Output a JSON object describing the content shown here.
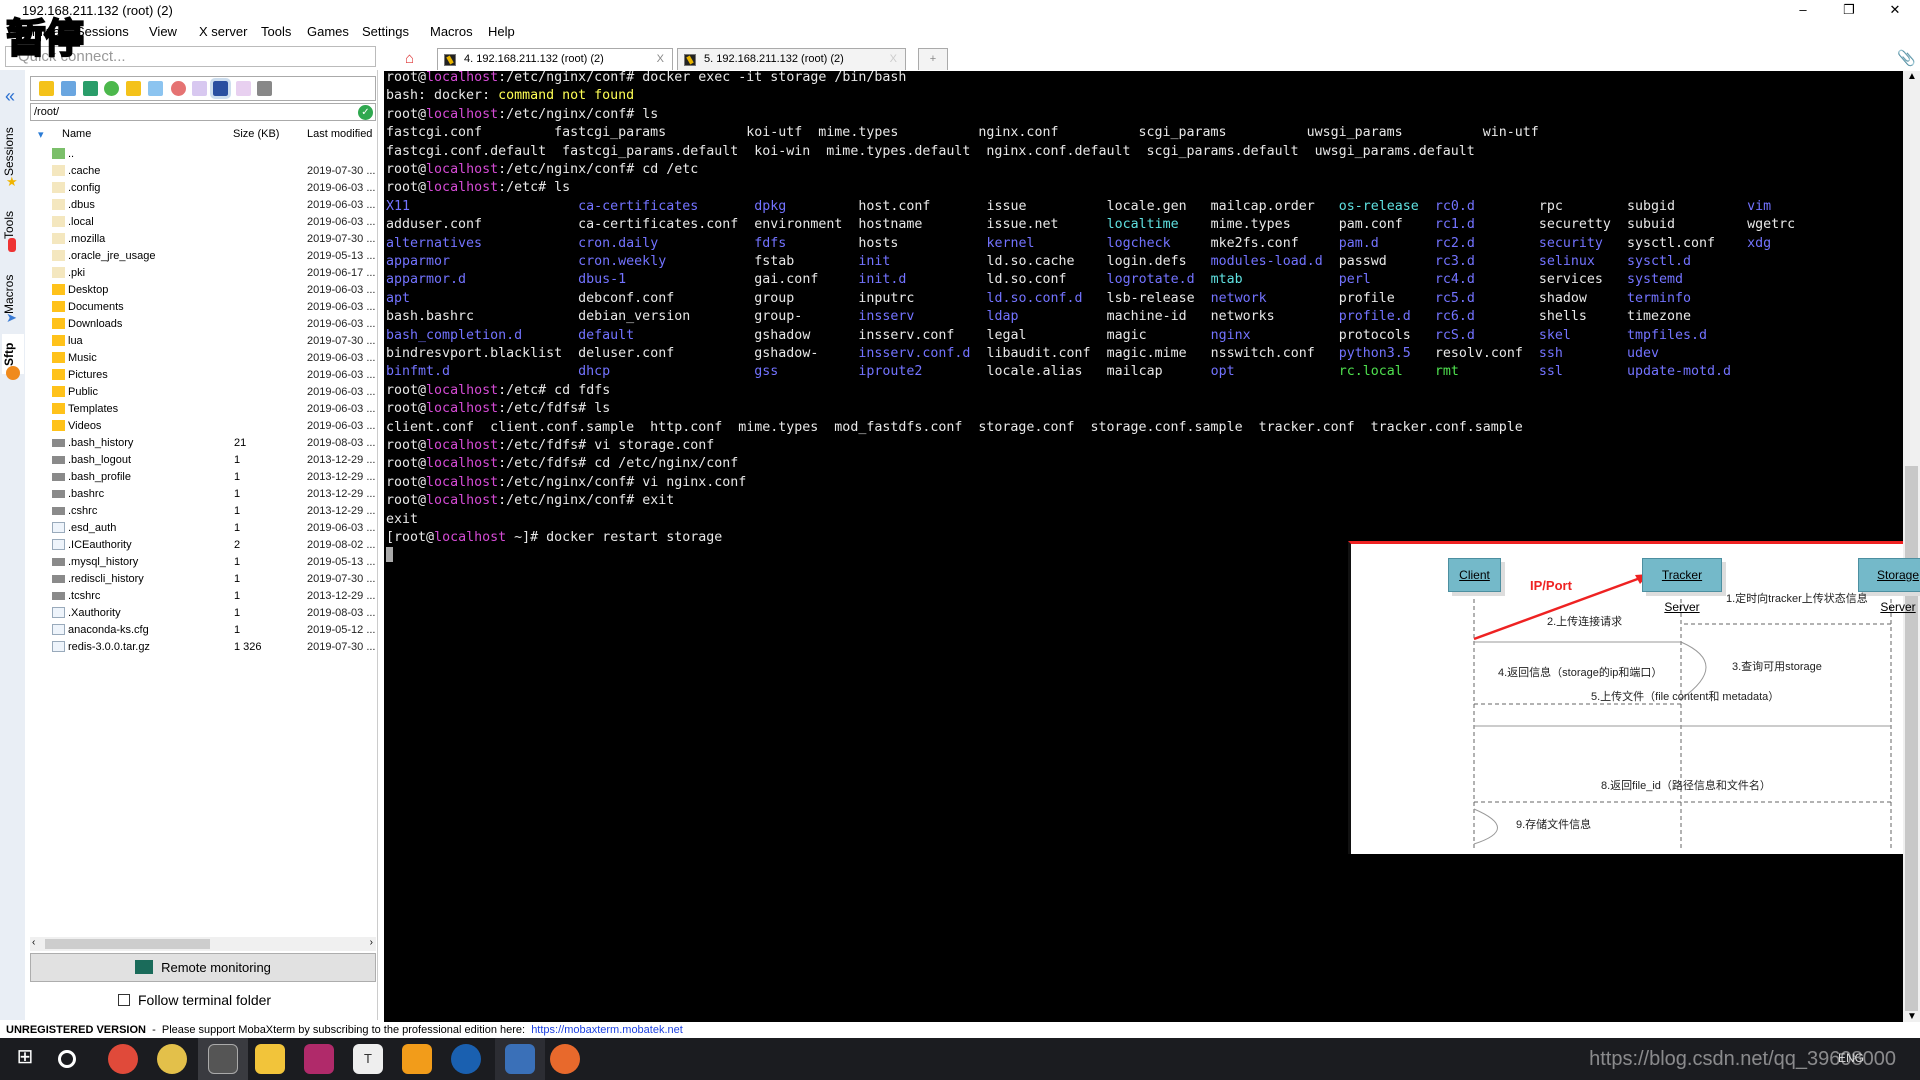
{
  "window": {
    "title": "192.168.211.132 (root) (2)",
    "minimize": "–",
    "maximize": "❐",
    "close": "✕"
  },
  "overlay_text": "暂停",
  "menu": [
    "Terminal",
    "Sessions",
    "View",
    "X server",
    "Tools",
    "Games",
    "Settings",
    "Macros",
    "Help"
  ],
  "quick_connect": {
    "placeholder": "Quick connect..."
  },
  "tabs": [
    {
      "label": "4. 192.168.211.132 (root) (2)",
      "close": "X",
      "active": true
    },
    {
      "label": "5. 192.168.211.132 (root) (2)",
      "close": "X",
      "active": false
    }
  ],
  "side_tabs": [
    "Sessions",
    "Tools",
    "Macros",
    "Sftp"
  ],
  "sftp": {
    "path": "/root/",
    "columns": {
      "name": "Name",
      "size": "Size (KB)",
      "modified": "Last modified"
    },
    "files": [
      {
        "name": "..",
        "size": "",
        "modified": "",
        "icon": "parent"
      },
      {
        "name": ".cache",
        "size": "",
        "modified": "2019-07-30 ...",
        "icon": "folder-dot"
      },
      {
        "name": ".config",
        "size": "",
        "modified": "2019-06-03 ...",
        "icon": "folder-dot"
      },
      {
        "name": ".dbus",
        "size": "",
        "modified": "2019-06-03 ...",
        "icon": "folder-dot"
      },
      {
        "name": ".local",
        "size": "",
        "modified": "2019-06-03 ...",
        "icon": "folder-dot"
      },
      {
        "name": ".mozilla",
        "size": "",
        "modified": "2019-07-30 ...",
        "icon": "folder-dot"
      },
      {
        "name": ".oracle_jre_usage",
        "size": "",
        "modified": "2019-05-13 ...",
        "icon": "folder-dot"
      },
      {
        "name": ".pki",
        "size": "",
        "modified": "2019-06-17 ...",
        "icon": "folder-dot"
      },
      {
        "name": "Desktop",
        "size": "",
        "modified": "2019-06-03 ...",
        "icon": "folder"
      },
      {
        "name": "Documents",
        "size": "",
        "modified": "2019-06-03 ...",
        "icon": "folder"
      },
      {
        "name": "Downloads",
        "size": "",
        "modified": "2019-06-03 ...",
        "icon": "folder"
      },
      {
        "name": "lua",
        "size": "",
        "modified": "2019-07-30 ...",
        "icon": "folder"
      },
      {
        "name": "Music",
        "size": "",
        "modified": "2019-06-03 ...",
        "icon": "folder"
      },
      {
        "name": "Pictures",
        "size": "",
        "modified": "2019-06-03 ...",
        "icon": "folder"
      },
      {
        "name": "Public",
        "size": "",
        "modified": "2019-06-03 ...",
        "icon": "folder"
      },
      {
        "name": "Templates",
        "size": "",
        "modified": "2019-06-03 ...",
        "icon": "folder"
      },
      {
        "name": "Videos",
        "size": "",
        "modified": "2019-06-03 ...",
        "icon": "folder"
      },
      {
        "name": ".bash_history",
        "size": "21",
        "modified": "2019-08-03 ...",
        "icon": "file-term"
      },
      {
        "name": ".bash_logout",
        "size": "1",
        "modified": "2013-12-29 ...",
        "icon": "file-term"
      },
      {
        "name": ".bash_profile",
        "size": "1",
        "modified": "2013-12-29 ...",
        "icon": "file-term"
      },
      {
        "name": ".bashrc",
        "size": "1",
        "modified": "2013-12-29 ...",
        "icon": "file-term"
      },
      {
        "name": ".cshrc",
        "size": "1",
        "modified": "2013-12-29 ...",
        "icon": "file-term"
      },
      {
        "name": ".esd_auth",
        "size": "1",
        "modified": "2019-06-03 ...",
        "icon": "file"
      },
      {
        "name": ".ICEauthority",
        "size": "2",
        "modified": "2019-08-02 ...",
        "icon": "file"
      },
      {
        "name": ".mysql_history",
        "size": "1",
        "modified": "2019-05-13 ...",
        "icon": "file-term"
      },
      {
        "name": ".rediscli_history",
        "size": "1",
        "modified": "2019-07-30 ...",
        "icon": "file-term"
      },
      {
        "name": ".tcshrc",
        "size": "1",
        "modified": "2013-12-29 ...",
        "icon": "file-term"
      },
      {
        "name": ".Xauthority",
        "size": "1",
        "modified": "2019-08-03 ...",
        "icon": "file"
      },
      {
        "name": "anaconda-ks.cfg",
        "size": "1",
        "modified": "2019-05-12 ...",
        "icon": "file"
      },
      {
        "name": "redis-3.0.0.tar.gz",
        "size": "1 326",
        "modified": "2019-07-30 ...",
        "icon": "file"
      }
    ],
    "remote_monitoring": "Remote monitoring",
    "follow_folder": "Follow terminal folder"
  },
  "terminal": {
    "user": "root",
    "at": "@",
    "host": "localhost",
    "lines_before": [
      {
        "p": "/etc/nginx/conf# ",
        "cmd": "docker exec -it storage /bin/bash"
      },
      {
        "plain": "bash: docker: ",
        "warn": "command not found"
      },
      {
        "p": "/etc/nginx/conf# ",
        "cmd": "ls"
      },
      {
        "plain": "fastcgi.conf         fastcgi_params          koi-utf  mime.types          nginx.conf          scgi_params          uwsgi_params          win-utf"
      },
      {
        "plain": "fastcgi.conf.default  fastcgi_params.default  koi-win  mime.types.default  nginx.conf.default  scgi_params.default  uwsgi_params.default"
      },
      {
        "p": "/etc/nginx/conf# ",
        "cmd": "cd /etc"
      },
      {
        "p": "/etc# ",
        "cmd": "ls"
      }
    ],
    "etc_columns": [
      24,
      46,
      59,
      75,
      90,
      103,
      119,
      131,
      144,
      155,
      170
    ],
    "etc_ls": [
      [
        {
          "t": "X11",
          "c": "d"
        },
        {
          "t": "adduser.conf"
        },
        {
          "t": "alternatives",
          "c": "d"
        },
        {
          "t": "apparmor",
          "c": "d"
        },
        {
          "t": "apparmor.d",
          "c": "d"
        },
        {
          "t": "apt",
          "c": "d"
        },
        {
          "t": "bash.bashrc"
        },
        {
          "t": "bash_completion.d",
          "c": "d"
        },
        {
          "t": "bindresvport.blacklist"
        },
        {
          "t": "binfmt.d",
          "c": "d"
        }
      ],
      [
        {
          "t": "ca-certificates",
          "c": "d"
        },
        {
          "t": "ca-certificates.conf"
        },
        {
          "t": "cron.daily",
          "c": "d"
        },
        {
          "t": "cron.weekly",
          "c": "d"
        },
        {
          "t": "dbus-1",
          "c": "d"
        },
        {
          "t": "debconf.conf"
        },
        {
          "t": "debian_version"
        },
        {
          "t": "default",
          "c": "d"
        },
        {
          "t": "deluser.conf"
        },
        {
          "t": "dhcp",
          "c": "d"
        }
      ],
      [
        {
          "t": "dpkg",
          "c": "d"
        },
        {
          "t": "environment"
        },
        {
          "t": "fdfs",
          "c": "d"
        },
        {
          "t": "fstab"
        },
        {
          "t": "gai.conf"
        },
        {
          "t": "group"
        },
        {
          "t": "group-"
        },
        {
          "t": "gshadow"
        },
        {
          "t": "gshadow-"
        },
        {
          "t": "gss",
          "c": "d"
        }
      ],
      [
        {
          "t": "host.conf"
        },
        {
          "t": "hostname"
        },
        {
          "t": "hosts"
        },
        {
          "t": "init",
          "c": "d"
        },
        {
          "t": "init.d",
          "c": "d"
        },
        {
          "t": "inputrc"
        },
        {
          "t": "insserv",
          "c": "d"
        },
        {
          "t": "insserv.conf"
        },
        {
          "t": "insserv.conf.d",
          "c": "d"
        },
        {
          "t": "iproute2",
          "c": "d"
        }
      ],
      [
        {
          "t": "issue"
        },
        {
          "t": "issue.net"
        },
        {
          "t": "kernel",
          "c": "d"
        },
        {
          "t": "ld.so.cache"
        },
        {
          "t": "ld.so.conf"
        },
        {
          "t": "ld.so.conf.d",
          "c": "d"
        },
        {
          "t": "ldap",
          "c": "d"
        },
        {
          "t": "legal"
        },
        {
          "t": "libaudit.conf"
        },
        {
          "t": "locale.alias"
        }
      ],
      [
        {
          "t": "locale.gen"
        },
        {
          "t": "localtime",
          "c": "c"
        },
        {
          "t": "logcheck",
          "c": "d"
        },
        {
          "t": "login.defs"
        },
        {
          "t": "logrotate.d",
          "c": "d"
        },
        {
          "t": "lsb-release"
        },
        {
          "t": "machine-id"
        },
        {
          "t": "magic"
        },
        {
          "t": "magic.mime"
        },
        {
          "t": "mailcap"
        }
      ],
      [
        {
          "t": "mailcap.order"
        },
        {
          "t": "mime.types"
        },
        {
          "t": "mke2fs.conf"
        },
        {
          "t": "modules-load.d",
          "c": "d"
        },
        {
          "t": "mtab",
          "c": "c"
        },
        {
          "t": "network",
          "c": "d"
        },
        {
          "t": "networks"
        },
        {
          "t": "nginx",
          "c": "d"
        },
        {
          "t": "nsswitch.conf"
        },
        {
          "t": "opt",
          "c": "d"
        }
      ],
      [
        {
          "t": "os-release",
          "c": "c"
        },
        {
          "t": "pam.conf"
        },
        {
          "t": "pam.d",
          "c": "d"
        },
        {
          "t": "passwd"
        },
        {
          "t": "perl",
          "c": "d"
        },
        {
          "t": "profile"
        },
        {
          "t": "profile.d",
          "c": "d"
        },
        {
          "t": "protocols"
        },
        {
          "t": "python3.5",
          "c": "d"
        },
        {
          "t": "rc.local",
          "c": "g"
        }
      ],
      [
        {
          "t": "rc0.d",
          "c": "d"
        },
        {
          "t": "rc1.d",
          "c": "d"
        },
        {
          "t": "rc2.d",
          "c": "d"
        },
        {
          "t": "rc3.d",
          "c": "d"
        },
        {
          "t": "rc4.d",
          "c": "d"
        },
        {
          "t": "rc5.d",
          "c": "d"
        },
        {
          "t": "rc6.d",
          "c": "d"
        },
        {
          "t": "rcS.d",
          "c": "d"
        },
        {
          "t": "resolv.conf"
        },
        {
          "t": "rmt",
          "c": "g"
        }
      ],
      [
        {
          "t": "rpc"
        },
        {
          "t": "securetty"
        },
        {
          "t": "security",
          "c": "d"
        },
        {
          "t": "selinux",
          "c": "d"
        },
        {
          "t": "services"
        },
        {
          "t": "shadow"
        },
        {
          "t": "shells"
        },
        {
          "t": "skel",
          "c": "d"
        },
        {
          "t": "ssh",
          "c": "d"
        },
        {
          "t": "ssl",
          "c": "d"
        }
      ],
      [
        {
          "t": "subgid"
        },
        {
          "t": "subuid"
        },
        {
          "t": "sysctl.conf"
        },
        {
          "t": "sysctl.d",
          "c": "d"
        },
        {
          "t": "systemd",
          "c": "d"
        },
        {
          "t": "terminfo",
          "c": "d"
        },
        {
          "t": "timezone"
        },
        {
          "t": "tmpfiles.d",
          "c": "d"
        },
        {
          "t": "udev",
          "c": "d"
        },
        {
          "t": "update-motd.d",
          "c": "d"
        }
      ],
      [
        {
          "t": "vim",
          "c": "d"
        },
        {
          "t": "wgetrc"
        },
        {
          "t": "xdg",
          "c": "d"
        }
      ]
    ],
    "lines_after": [
      {
        "p": "/etc# ",
        "cmd": "cd fdfs"
      },
      {
        "p": "/etc/fdfs# ",
        "cmd": "ls"
      },
      {
        "plain": "client.conf  client.conf.sample  http.conf  mime.types  mod_fastdfs.conf  storage.conf  storage.conf.sample  tracker.conf  tracker.conf.sample"
      },
      {
        "p": "/etc/fdfs# ",
        "cmd": "vi storage.conf"
      },
      {
        "p": "/etc/fdfs# ",
        "cmd": "cd /etc/nginx/conf"
      },
      {
        "p": "/etc/nginx/conf# ",
        "cmd": "vi nginx.conf"
      },
      {
        "p": "/etc/nginx/conf# ",
        "cmd": "exit"
      },
      {
        "plain": "exit"
      },
      {
        "bracket": true,
        "p": " ~]# ",
        "cmd": "docker restart storage"
      }
    ]
  },
  "diagram": {
    "client": "Client",
    "tracker": "Tracker Server",
    "storage": "Storage Server",
    "ipport": "IP/Port",
    "steps": [
      "1.定时向tracker上传状态信息",
      "2.上传连接请求",
      "3.查询可用storage",
      "4.返回信息（storage的ip和端口）",
      "5.上传文件（file content和 metadata）",
      "8.返回file_id（路径信息和文件名）",
      "9.存储文件信息"
    ]
  },
  "status": {
    "label": "UNREGISTERED VERSION",
    "message": "  -  Please support MobaXterm by subscribing to the professional edition here:  ",
    "link": "https://mobaxterm.mobatek.net"
  },
  "taskbar": {
    "apps": [
      "windows-start",
      "cortana",
      "chrome",
      "app-yellow",
      "mobaxterm",
      "file-explorer",
      "intellij",
      "typora",
      "vmware",
      "app-red-blue",
      "sublime-like",
      "postman"
    ],
    "tray": "ENG"
  },
  "watermark": "https://blog.csdn.net/qq_39608000",
  "colors": {
    "host": "#d54bd5",
    "dir": "#7373ff",
    "cyan": "#5fe0e0",
    "green": "#4ee04e",
    "warn": "#ffff55",
    "accent_red": "#e22222"
  }
}
